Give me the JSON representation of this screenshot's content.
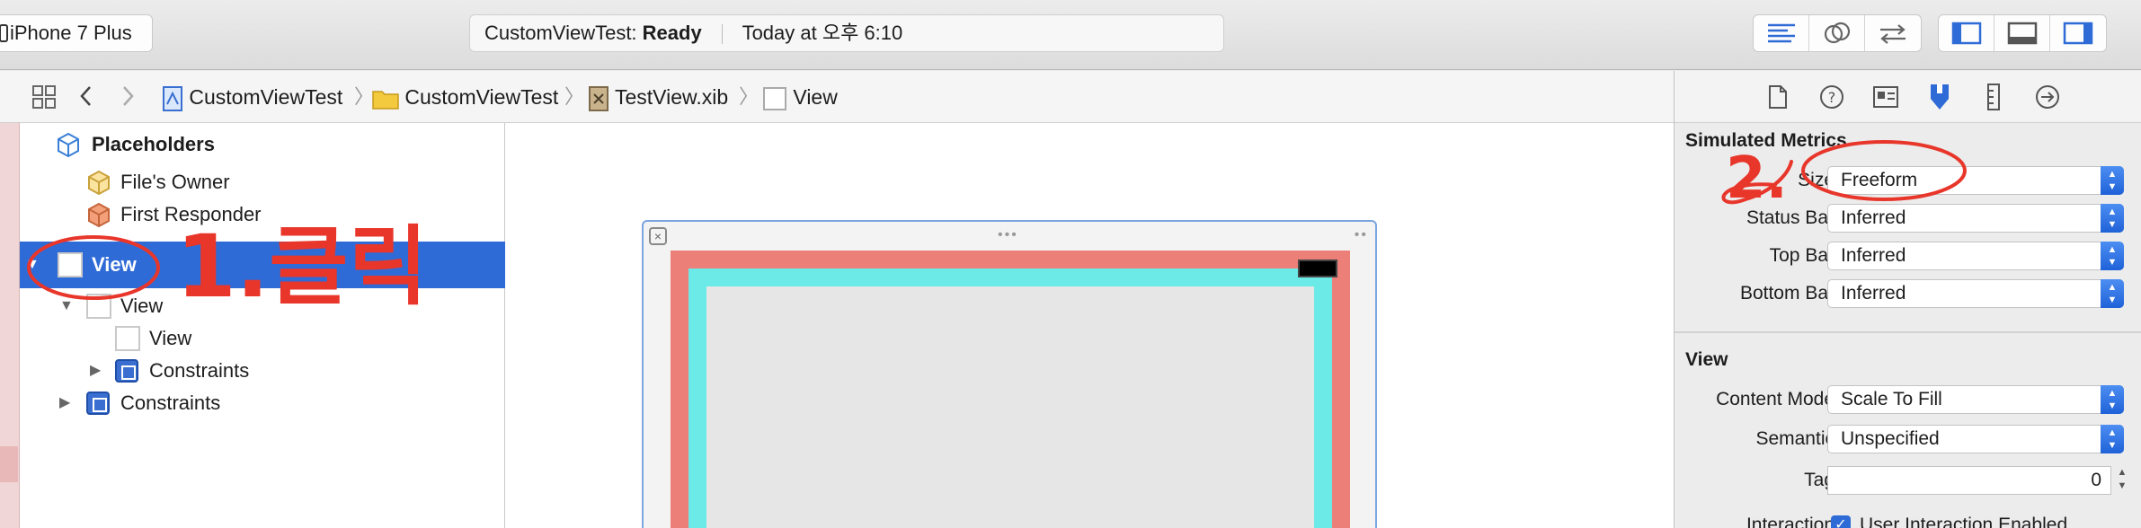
{
  "toolbar": {
    "scheme_device": "iPhone 7 Plus",
    "activity_project": "CustomViewTest:",
    "activity_status": "Ready",
    "activity_time": "Today at 오후 6:10",
    "editor_mode_icons": [
      "standard-editor-icon",
      "assistant-editor-icon",
      "version-editor-icon"
    ],
    "view_toggle_icons": [
      "navigator-toggle-icon",
      "debug-area-toggle-icon",
      "utilities-toggle-icon"
    ]
  },
  "jumpbar": {
    "items": [
      "CustomViewTest",
      "CustomViewTest",
      "TestView.xib",
      "View"
    ]
  },
  "outline": {
    "placeholders": "Placeholders",
    "files_owner": "File's Owner",
    "first_responder": "First Responder",
    "root_view": "View",
    "child_view": "View",
    "grandchild_view": "View",
    "child_constraints": "Constraints",
    "root_constraints": "Constraints"
  },
  "inspector": {
    "simulated_metrics": {
      "title": "Simulated Metrics",
      "size_label": "Size",
      "size_value": "Freeform",
      "status_bar_label": "Status Bar",
      "status_bar_value": "Inferred",
      "top_bar_label": "Top Bar",
      "top_bar_value": "Inferred",
      "bottom_bar_label": "Bottom Bar",
      "bottom_bar_value": "Inferred"
    },
    "view": {
      "title": "View",
      "content_mode_label": "Content Mode",
      "content_mode_value": "Scale To Fill",
      "semantic_label": "Semantic",
      "semantic_value": "Unspecified",
      "tag_label": "Tag",
      "tag_value": "0",
      "interaction_label": "Interaction",
      "user_interaction_label": "User Interaction Enabled"
    }
  },
  "annotations": {
    "step1": "1.클릭",
    "step2": "2."
  },
  "colors": {
    "selection": "#2f6bd6",
    "view_red": "#ec7f77",
    "view_cyan": "#6ceae8",
    "annotation_red": "#e8362b"
  }
}
